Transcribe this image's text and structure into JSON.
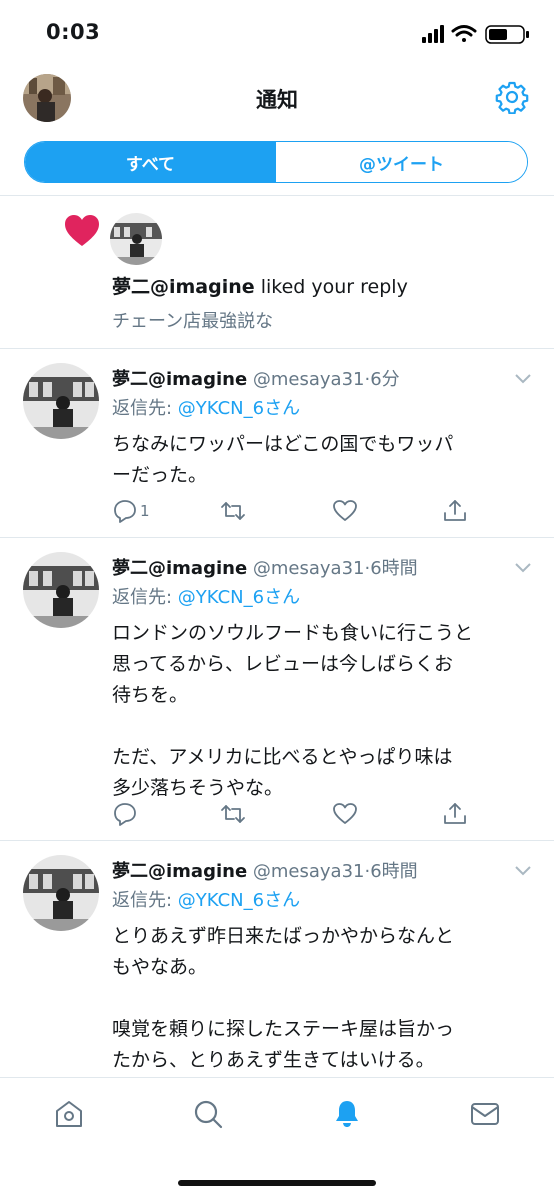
{
  "status": {
    "time": "0:03"
  },
  "header": {
    "title": "通知"
  },
  "tabs": [
    {
      "label": "すべて"
    },
    {
      "label": "@ツイート"
    }
  ],
  "colors": {
    "accent": "#1da1f2",
    "like": "#e0245e",
    "secondary_text": "#657786"
  },
  "like_notification": {
    "icon": "heart-icon",
    "name": "夢二@imagine",
    "action": "liked your reply",
    "snippet": "チェーン店最強説な"
  },
  "tweets": [
    {
      "name": "夢二@imagine",
      "handle": "@mesaya31",
      "time": "6分",
      "reply_prefix": "返信先: ",
      "reply_to": "@YKCN_6さん",
      "text": "ちなみにワッパーはどこの国でもワッパ\nーだった。",
      "reply_count": "1"
    },
    {
      "name": "夢二@imagine",
      "handle": "@mesaya31",
      "time": "6時間",
      "reply_prefix": "返信先: ",
      "reply_to": "@YKCN_6さん",
      "text": "ロンドンのソウルフードも食いに行こうと\n思ってるから、レビューは今しばらくお\n待ちを。\n\nただ、アメリカに比べるとやっぱり味は\n多少落ちそうやな。",
      "reply_count": ""
    },
    {
      "name": "夢二@imagine",
      "handle": "@mesaya31",
      "time": "6時間",
      "reply_prefix": "返信先: ",
      "reply_to": "@YKCN_6さん",
      "text": "とりあえず昨日来たばっかやからなんと\nもやなあ。\n\n嗅覚を頼りに探したステーキ屋は旨かっ\nたから、とりあえず生きてはいける。",
      "reply_count": ""
    }
  ],
  "tabbar": [
    {
      "icon": "home-icon"
    },
    {
      "icon": "search-icon"
    },
    {
      "icon": "notifications-bell-icon",
      "active": true
    },
    {
      "icon": "messages-envelope-icon"
    }
  ]
}
